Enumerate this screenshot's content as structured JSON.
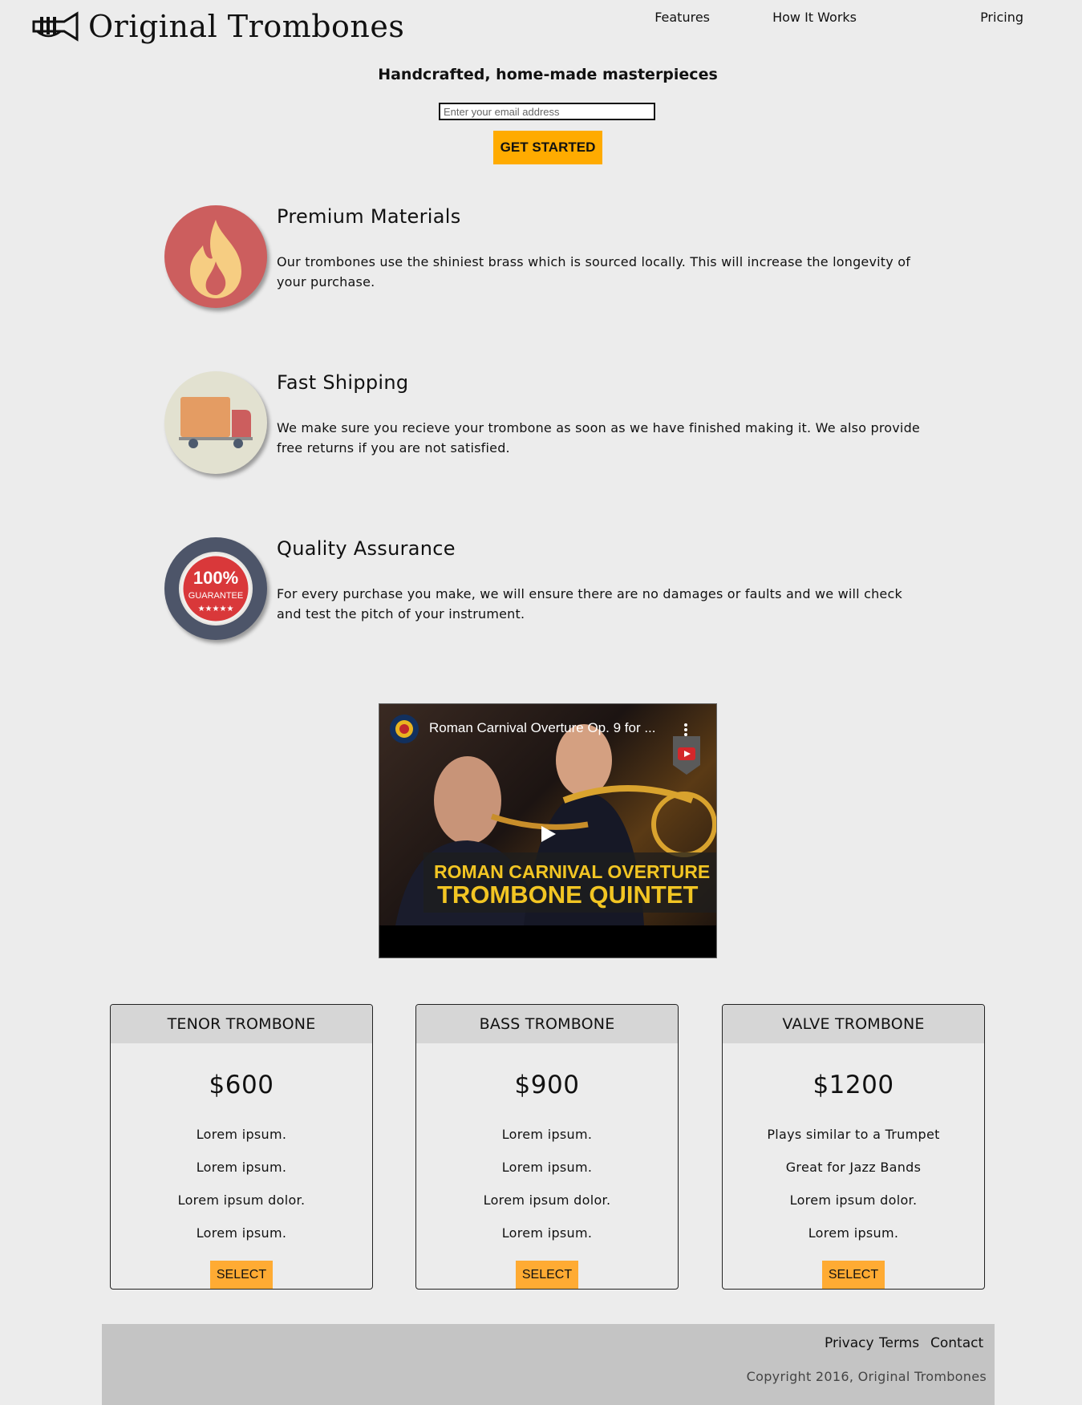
{
  "header": {
    "logo_text": "Original Trombones",
    "nav": [
      "Features",
      "How It Works",
      "Pricing"
    ]
  },
  "hero": {
    "title": "Handcrafted, home-made masterpieces",
    "email_placeholder": "Enter your email address",
    "cta_label": "GET STARTED"
  },
  "features": [
    {
      "icon": "flame-icon",
      "title": "Premium Materials",
      "text": "Our trombones use the shiniest brass which is sourced locally. This will increase the longevity of your purchase."
    },
    {
      "icon": "truck-icon",
      "title": "Fast Shipping",
      "text": "We make sure you recieve your trombone as soon as we have finished making it. We also provide free returns if you are not satisfied."
    },
    {
      "icon": "guarantee-badge-icon",
      "title": "Quality Assurance",
      "text": "For every purchase you make, we will ensure there are no damages or faults and we will check and test the pitch of your instrument."
    }
  ],
  "video": {
    "title": "Roman Carnival Overture Op. 9 for ...",
    "caption_line1": "ROMAN CARNIVAL OVERTURE",
    "caption_line2": "TROMBONE QUINTET"
  },
  "badge": {
    "line1": "100%",
    "line2": "GUARANTEE",
    "stars": "★★★★★"
  },
  "pricing": [
    {
      "name": "TENOR TROMBONE",
      "price": "$600",
      "features": [
        "Lorem ipsum.",
        "Lorem ipsum.",
        "Lorem ipsum dolor.",
        "Lorem ipsum."
      ],
      "button": "SELECT"
    },
    {
      "name": "BASS TROMBONE",
      "price": "$900",
      "features": [
        "Lorem ipsum.",
        "Lorem ipsum.",
        "Lorem ipsum dolor.",
        "Lorem ipsum."
      ],
      "button": "SELECT"
    },
    {
      "name": "VALVE TROMBONE",
      "price": "$1200",
      "features": [
        "Plays similar to a Trumpet",
        "Great for Jazz Bands",
        "Lorem ipsum dolor.",
        "Lorem ipsum."
      ],
      "button": "SELECT"
    }
  ],
  "footer": {
    "links": [
      "Privacy",
      "Terms",
      "Contact"
    ],
    "copyright": "Copyright 2016, Original Trombones"
  },
  "colors": {
    "background": "#ececec",
    "accent": "#ffab00",
    "select_button": "#ffab33",
    "card_header": "#d6d6d6",
    "footer": "#c4c4c4"
  }
}
